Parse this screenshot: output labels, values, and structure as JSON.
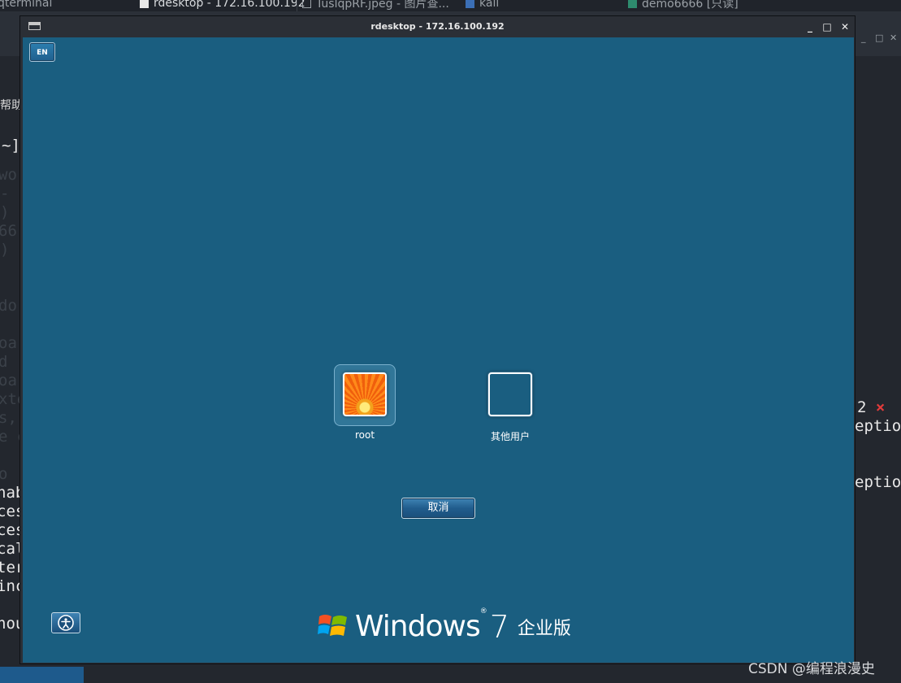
{
  "taskbar": {
    "items": [
      {
        "label": "qterminal"
      },
      {
        "label": "rdesktop - 172.16.100.192"
      },
      {
        "label": "TuslqpRF.jpeg - 图片查..."
      },
      {
        "label": "kali"
      },
      {
        "label": "demo6666 [只读]"
      }
    ]
  },
  "terminal": {
    "menu_fragment": "帮助",
    "prompt_fragment": "~]",
    "faded_lines": [
      "wor",
      "-",
      ")",
      "66",
      ")",
      "do",
      "oa",
      "d",
      "oa",
      "xte",
      "s,",
      "e c",
      "o"
    ],
    "lines_left": [
      "nab",
      "ces",
      "ces",
      "cal",
      "ter",
      "inc",
      "hou"
    ],
    "lines_right": [
      "2",
      "eptio",
      "eptio"
    ]
  },
  "window": {
    "title": "rdesktop - 172.16.100.192",
    "controls": {
      "minimize": "_",
      "maximize": "□",
      "close": "✕"
    }
  },
  "login": {
    "language_indicator": "EN",
    "users": [
      {
        "name": "root",
        "picture": "orange-flower"
      },
      {
        "name": "其他用户",
        "picture": "blank"
      }
    ],
    "cancel_label": "取消",
    "brand": {
      "windows": "Windows",
      "version": "7",
      "edition": "企业版"
    }
  },
  "watermark": "CSDN @编程浪漫史",
  "colors": {
    "login_background": "#1a5e80",
    "terminal_background": "#23272e",
    "titlebar": "#2b2f36"
  }
}
